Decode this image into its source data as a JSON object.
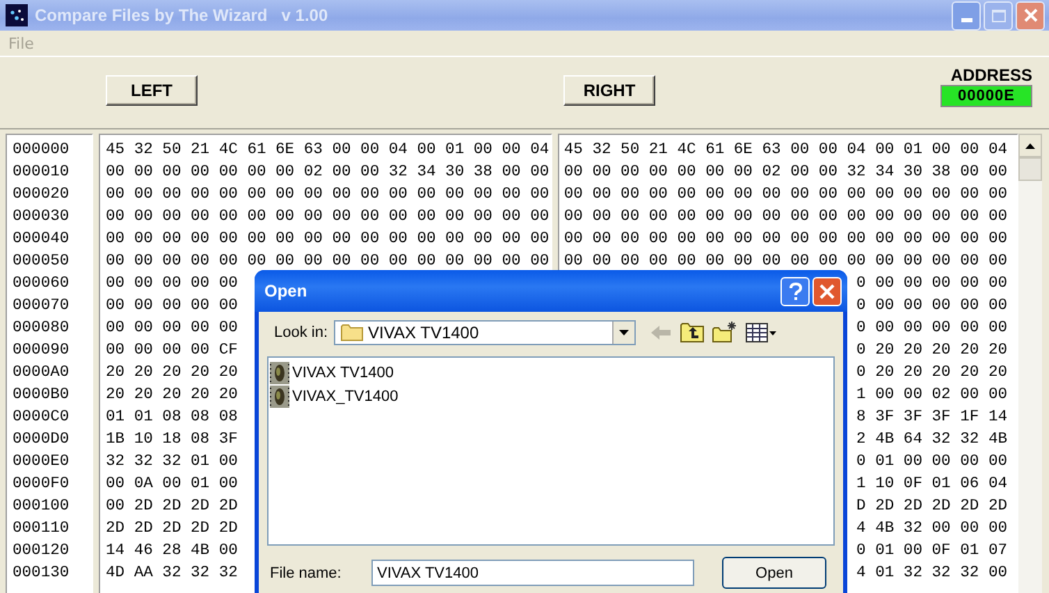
{
  "window": {
    "title": "Compare Files by The Wizard   v 1.00"
  },
  "menu": [
    {
      "label": "File",
      "disabled": true
    }
  ],
  "toolbar": {
    "left_button": "LEFT",
    "right_button": "RIGHT",
    "address_label": "ADDRESS",
    "address_value": "00000E"
  },
  "hex_rows": [
    {
      "address": "000000",
      "left": "45 32 50 21 4C 61 6E 63 00 00 04 00 01 00 00 04",
      "right": "45 32 50 21 4C 61 6E 63 00 00 04 00 01 00 00 04"
    },
    {
      "address": "000010",
      "left": "00 00 00 00 00 00 00 02 00 00 32 34 30 38 00 00",
      "right": "00 00 00 00 00 00 00 02 00 00 32 34 30 38 00 00"
    },
    {
      "address": "000020",
      "left": "00 00 00 00 00 00 00 00 00 00 00 00 00 00 00 00",
      "right": "00 00 00 00 00 00 00 00 00 00 00 00 00 00 00 00"
    },
    {
      "address": "000030",
      "left": "00 00 00 00 00 00 00 00 00 00 00 00 00 00 00 00",
      "right": "00 00 00 00 00 00 00 00 00 00 00 00 00 00 00 00"
    },
    {
      "address": "000040",
      "left": "00 00 00 00 00 00 00 00 00 00 00 00 00 00 00 00",
      "right": "00 00 00 00 00 00 00 00 00 00 00 00 00 00 00 00"
    },
    {
      "address": "000050",
      "left": "00 00 00 00 00 00 00 00 00 00 00 00 00 00 00 00",
      "right": "00 00 00 00 00 00 00 00 00 00 00 00 00 00 00 00"
    },
    {
      "address": "000060",
      "left": "00 00 00 00 00",
      "right": "0 00 00 00 00 00"
    },
    {
      "address": "000070",
      "left": "00 00 00 00 00",
      "right": "0 00 00 00 00 00"
    },
    {
      "address": "000080",
      "left": "00 00 00 00 00",
      "right": "0 00 00 00 00 00"
    },
    {
      "address": "000090",
      "left": "00 00 00 00 CF",
      "right": "0 20 20 20 20 20"
    },
    {
      "address": "0000A0",
      "left": "20 20 20 20 20",
      "right": "0 20 20 20 20 20"
    },
    {
      "address": "0000B0",
      "left": "20 20 20 20 20",
      "right": "1 00 00 02 00 00"
    },
    {
      "address": "0000C0",
      "left": "01 01 08 08 08",
      "right": "8 3F 3F 3F 1F 14"
    },
    {
      "address": "0000D0",
      "left": "1B 10 18 08 3F",
      "right": "2 4B 64 32 32 4B"
    },
    {
      "address": "0000E0",
      "left": "32 32 32 01 00",
      "right": "0 01 00 00 00 00"
    },
    {
      "address": "0000F0",
      "left": "00 0A 00 01 00",
      "right": "1 10 0F 01 06 04"
    },
    {
      "address": "000100",
      "left": "00 2D 2D 2D 2D",
      "right": "D 2D 2D 2D 2D 2D"
    },
    {
      "address": "000110",
      "left": "2D 2D 2D 2D 2D",
      "right": "4 4B 32 00 00 00"
    },
    {
      "address": "000120",
      "left": "14 46 28 4B 00",
      "right": "0 01 00 0F 01 07"
    },
    {
      "address": "000130",
      "left": "4D AA 32 32 32",
      "right": "4 01 32 32 32 00"
    }
  ],
  "open_dialog": {
    "title": "Open",
    "look_in_label": "Look in:",
    "look_in_value": "VIVAX TV1400",
    "tools": [
      {
        "kind": "back",
        "disabled": true
      },
      {
        "kind": "up",
        "disabled": false
      },
      {
        "kind": "new-folder",
        "disabled": false
      },
      {
        "kind": "views",
        "disabled": false
      }
    ],
    "files": [
      {
        "name": "VIVAX TV1400"
      },
      {
        "name": "VIVAX_TV1400"
      }
    ],
    "file_name_label": "File name:",
    "file_name_value": "VIVAX TV1400",
    "open_button": "Open"
  }
}
